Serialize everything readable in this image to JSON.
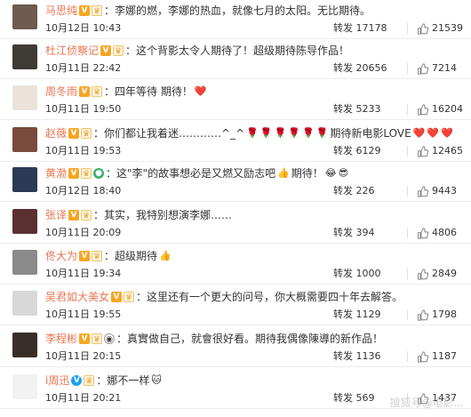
{
  "comments": [
    {
      "username": "马思纯",
      "badges": [
        "v-yellow",
        "crown"
      ],
      "text": "李娜的燃，李娜的热血，就像七月的太阳。无比期待。",
      "emojis": [],
      "time": "10月12日 10:43",
      "repost_label": "转发",
      "reposts": "17178",
      "likes": "21539",
      "avatar_color": "#6e5a4f"
    },
    {
      "username": "杜江侦察记",
      "badges": [
        "v-yellow",
        "crown"
      ],
      "text": "这个背影太令人期待了！超级期待陈导作品！",
      "emojis": [],
      "time": "10月11日 22:42",
      "repost_label": "转发",
      "reposts": "20656",
      "likes": "7214",
      "avatar_color": "#3e3a35"
    },
    {
      "username": "周冬雨",
      "badges": [
        "v-yellow",
        "crown"
      ],
      "text": "四年等待 期待！",
      "emojis": [
        "heart"
      ],
      "time": "10月11日 19:50",
      "repost_label": "转发",
      "reposts": "5233",
      "likes": "16204",
      "avatar_color": "#e9e3d9"
    },
    {
      "username": "赵薇",
      "badges": [
        "v-yellow",
        "crown"
      ],
      "text": "你们都让我着迷…………^_^",
      "text_tail": "期待新电影LOVE",
      "emojis": [
        "rose",
        "rose",
        "rose",
        "rose",
        "rose",
        "rose"
      ],
      "emojis_tail": [
        "heart",
        "heart",
        "heart"
      ],
      "time": "10月11日 19:53",
      "repost_label": "转发",
      "reposts": "6129",
      "likes": "12465",
      "avatar_color": "#7a4a3c"
    },
    {
      "username": "黄渤",
      "badges": [
        "v-yellow",
        "crown",
        "green"
      ],
      "text": "这\"李\"的故事想必是又燃又励志吧",
      "text_tail": "期待！",
      "emojis": [
        "thumbs-up"
      ],
      "emojis_tail": [
        "laugh-cry",
        "sunglasses"
      ],
      "time": "10月12日 18:40",
      "repost_label": "转发",
      "reposts": "226",
      "likes": "9443",
      "avatar_color": "#2b3b55"
    },
    {
      "username": "张译",
      "badges": [
        "v-yellow",
        "crown"
      ],
      "text": "其实，我特别想演李娜……",
      "emojis": [],
      "time": "10月11日 20:09",
      "repost_label": "转发",
      "reposts": "394",
      "likes": "4806",
      "avatar_color": "#5a3030"
    },
    {
      "username": "佟大为",
      "badges": [
        "v-yellow",
        "crown"
      ],
      "text": "超级期待",
      "emojis": [
        "thumbs-up"
      ],
      "time": "10月11日 19:34",
      "repost_label": "转发",
      "reposts": "1000",
      "likes": "2849",
      "avatar_color": "#8a8a8a"
    },
    {
      "username": "吴君如大美女",
      "badges": [
        "v-yellow",
        "crown"
      ],
      "text": "这里还有一个更大的问号，你大概需要四十年去解答。",
      "emojis": [],
      "time": "10月11日 19:55",
      "repost_label": "转发",
      "reposts": "1129",
      "likes": "1798",
      "avatar_color": "#d8d8d8"
    },
    {
      "username": "李程彬",
      "badges": [
        "v-yellow",
        "crown",
        "panda"
      ],
      "text": "真實做自己，就會很好看。期待我偶像陳導的新作品！",
      "emojis": [],
      "time": "10月11日 20:15",
      "repost_label": "转发",
      "reposts": "1136",
      "likes": "1187",
      "avatar_color": "#3a2e28"
    },
    {
      "username": "i周迅",
      "badges": [
        "v-blue",
        "crown"
      ],
      "text": "娜不一样",
      "emojis": [
        "cat"
      ],
      "time": "10月11日 20:21",
      "repost_label": "转发",
      "reposts": "569",
      "likes": "1437",
      "avatar_color": "#f2f2f2"
    }
  ],
  "watermark": "搜狐号@电影...",
  "colors": {
    "username": "#eb7350",
    "badge_v_yellow": "#f6a623",
    "badge_v_blue": "#1da1f2",
    "divider": "#ececec"
  }
}
